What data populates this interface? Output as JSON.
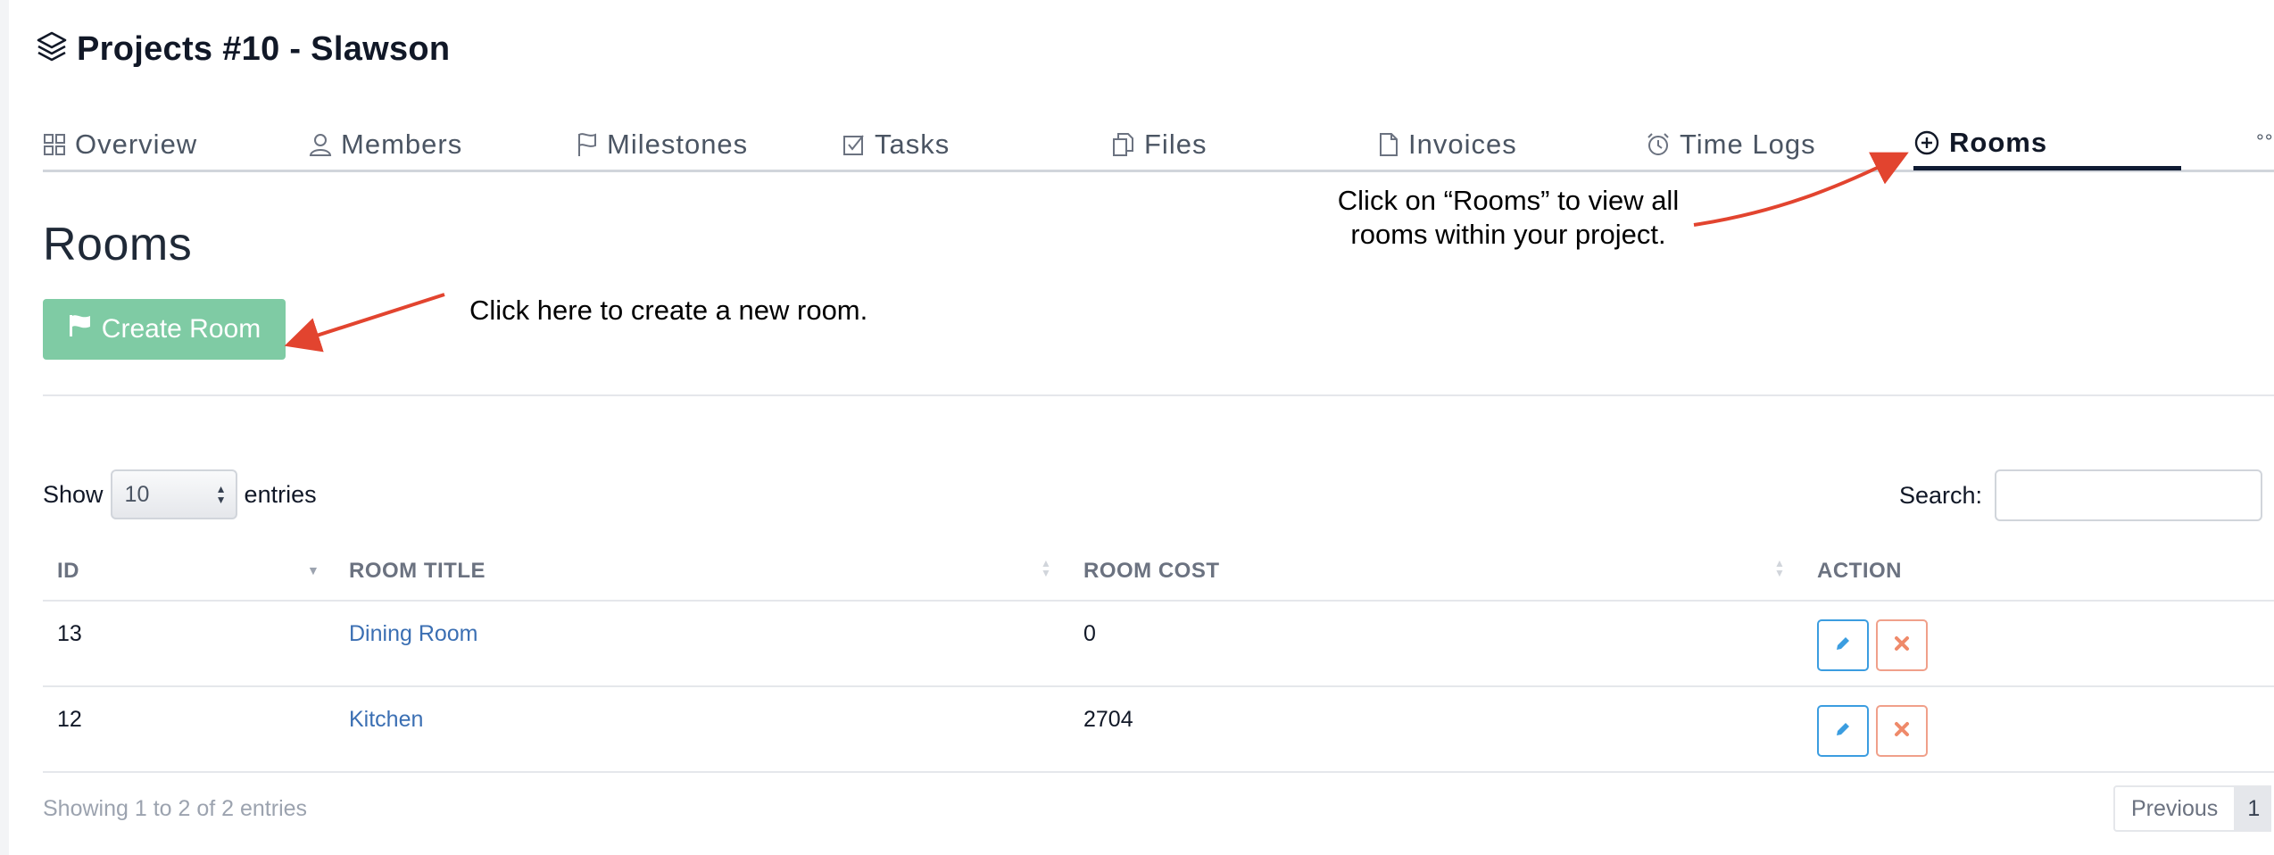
{
  "header": {
    "title": "Projects #10 - Slawson",
    "icon": "layers-icon"
  },
  "tabs": [
    {
      "label": "Overview",
      "icon": "grid-icon"
    },
    {
      "label": "Members",
      "icon": "user-icon"
    },
    {
      "label": "Milestones",
      "icon": "flag-icon"
    },
    {
      "label": "Tasks",
      "icon": "checkbox-icon"
    },
    {
      "label": "Files",
      "icon": "files-icon"
    },
    {
      "label": "Invoices",
      "icon": "document-icon"
    },
    {
      "label": "Time Logs",
      "icon": "alarm-clock-icon"
    },
    {
      "label": "Rooms",
      "icon": "plus-circle-icon",
      "active": true
    }
  ],
  "tabs_more": "°°",
  "section": {
    "title": "Rooms"
  },
  "create_button": {
    "label": "Create Room",
    "color": "#7fcba4"
  },
  "annotations": {
    "rooms": "Click on “Rooms” to view all rooms within your project.",
    "create": "Click here to create a new room.",
    "arrow_color": "#e2442f"
  },
  "table_controls": {
    "show_label": "Show",
    "entries_value": "10",
    "entries_label": "entries",
    "search_label": "Search:",
    "search_value": ""
  },
  "table": {
    "columns": [
      "ID",
      "ROOM TITLE",
      "ROOM COST",
      "ACTION"
    ],
    "rows": [
      {
        "id": "13",
        "title": "Dining Room",
        "cost": "0"
      },
      {
        "id": "12",
        "title": "Kitchen",
        "cost": "2704"
      }
    ]
  },
  "footer": {
    "info": "Showing 1 to 2 of 2 entries",
    "previous": "Previous",
    "page": "1"
  }
}
